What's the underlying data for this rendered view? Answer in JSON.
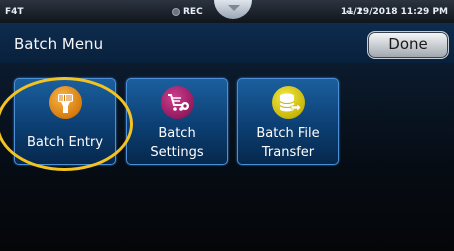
{
  "status_bar": {
    "device": "F4T",
    "rec": "REC",
    "usb": "1",
    "datetime": "11/29/2018 11:29 PM"
  },
  "header": {
    "title": "Batch Menu",
    "done_label": "Done"
  },
  "tiles": [
    {
      "label": "Batch Entry",
      "icon": "barcode-scanner-icon",
      "color": "#d67b0c"
    },
    {
      "label_line1": "Batch",
      "label_line2": "Settings",
      "icon": "cart-gear-icon",
      "color": "#951a5f"
    },
    {
      "label_line1": "Batch File",
      "label_line2": "Transfer",
      "icon": "database-transfer-icon",
      "color": "#c8b60a"
    }
  ],
  "colors": {
    "header_bg": "#0b2645",
    "tile_bg": "#0c3f73",
    "highlight": "#f2c321"
  }
}
